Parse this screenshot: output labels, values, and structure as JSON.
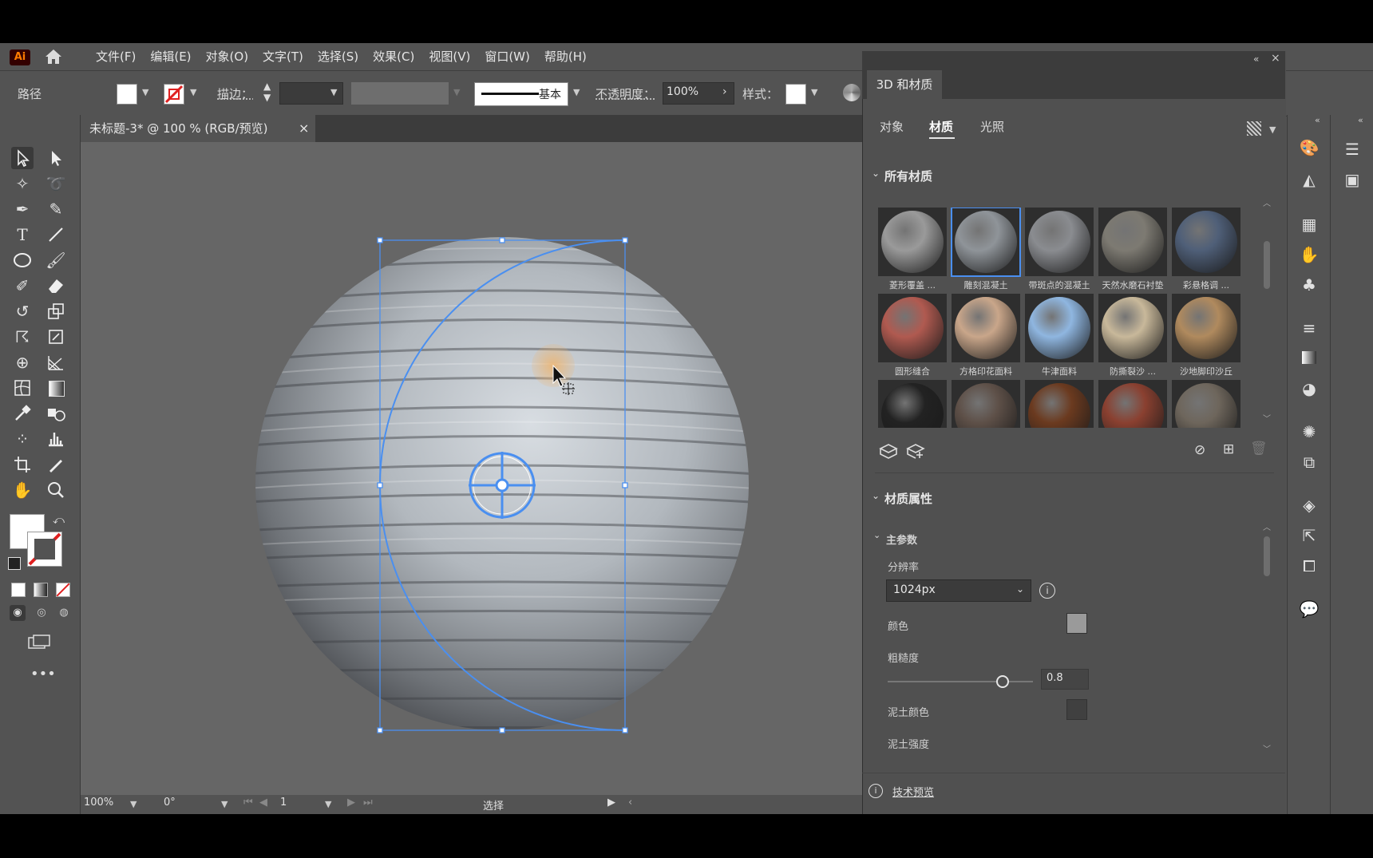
{
  "app": {
    "logo": "Ai"
  },
  "menu": [
    "文件(F)",
    "编辑(E)",
    "对象(O)",
    "文字(T)",
    "选择(S)",
    "效果(C)",
    "视图(V)",
    "窗口(W)",
    "帮助(H)"
  ],
  "control_bar": {
    "object_type": "路径",
    "stroke_label": "描边：",
    "stroke_style": "基本",
    "opacity_label": "不透明度：",
    "opacity_value": "100%",
    "style_label": "样式："
  },
  "document_tab": {
    "title": "未标题-3* @ 100 % (RGB/预览)",
    "close": "×"
  },
  "status_bar": {
    "zoom": "100%",
    "rotation": "0°",
    "artboard": "1",
    "mode": "选择"
  },
  "panel": {
    "title": "3D 和材质",
    "tabs": [
      "对象",
      "材质",
      "光照"
    ],
    "active_tab": "材质",
    "all_materials_title": "所有材质",
    "materials": [
      {
        "label": "菱形覆盖 ...",
        "color": "#9a9a9a"
      },
      {
        "label": "雕刻混凝土",
        "color": "#8f9499",
        "selected": true
      },
      {
        "label": "带斑点的混凝土",
        "color": "#8a8c90"
      },
      {
        "label": "天然水磨石衬垫",
        "color": "#7d7a72"
      },
      {
        "label": "彩悬格调 ...",
        "color": "#4f5f78"
      },
      {
        "label": "圆形缝合",
        "color": "#b05a50"
      },
      {
        "label": "方格印花面料",
        "color": "#c9a68a"
      },
      {
        "label": "牛津面料",
        "color": "#8fb6e0"
      },
      {
        "label": "防撕裂沙 ...",
        "color": "#c8b89a"
      },
      {
        "label": "沙地脚印沙丘",
        "color": "#b08a5e"
      },
      {
        "label": "",
        "color": "#222222"
      },
      {
        "label": "",
        "color": "#5e5048"
      },
      {
        "label": "",
        "color": "#6b3a1f"
      },
      {
        "label": "",
        "color": "#8a4030"
      },
      {
        "label": "",
        "color": "#6e665c"
      }
    ],
    "material_properties_title": "材质属性",
    "main_params_title": "主参数",
    "resolution_label": "分辨率",
    "resolution_value": "1024px",
    "color_label": "颜色",
    "color_value": "#9a9a9a",
    "roughness_label": "粗糙度",
    "roughness_value": "0.8",
    "dirt_color_label": "泥土颜色",
    "dirt_color_value": "#404040",
    "dirt_strength_label": "泥土强度",
    "tech_preview": "技术预览"
  },
  "colors": {
    "accent": "#4a8ff0",
    "panel_bg": "#505050",
    "canvas_bg": "#666666"
  }
}
